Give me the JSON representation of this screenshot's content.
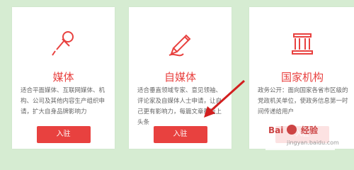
{
  "cards": [
    {
      "title": "媒体",
      "icon": "microphone-icon",
      "description": "适合平面媒体、互联网媒体、机构、公司及其他内容生产组织申请，扩大自身品牌影响力",
      "button": "入驻"
    },
    {
      "title": "自媒体",
      "icon": "pen-icon",
      "description": "适合垂直领域专家、意见领袖、评论家及自媒体人士申请，让自己更有影响力，每篇文章都能上头条",
      "button": "入驻"
    },
    {
      "title": "国家机构",
      "icon": "government-building-icon",
      "description": "政务公开：面向国家各省市区级的党政机关单位，使政务信息第一时间传递给用户",
      "button": "入驻"
    }
  ],
  "watermark": {
    "left": "Bai",
    "right": "经验",
    "url": "jingyan.baidu.com"
  },
  "colors": {
    "accent": "#e8413f",
    "background": "#d6ecd2",
    "card": "#ffffff"
  }
}
